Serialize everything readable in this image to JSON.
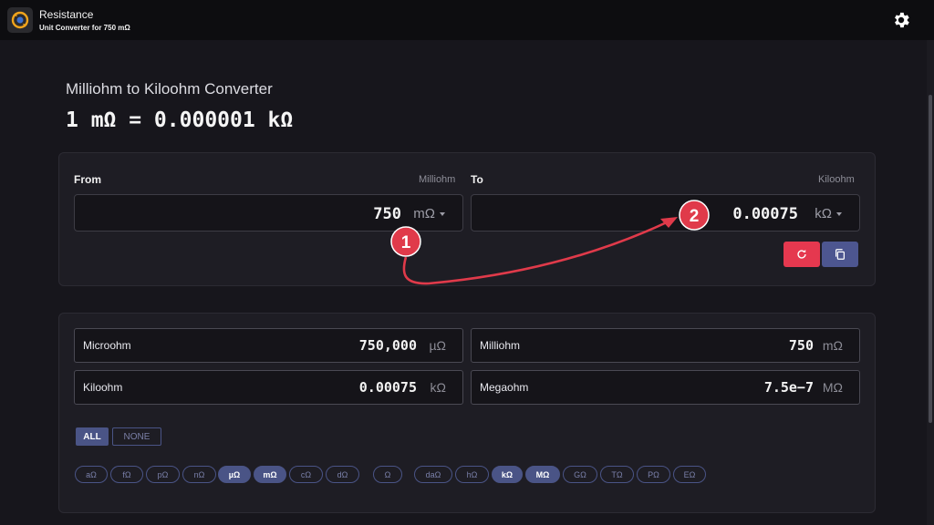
{
  "header": {
    "title": "Resistance",
    "subtitle": "Unit Converter for 750 mΩ"
  },
  "page": {
    "heading": "Milliohm to Kiloohm Converter",
    "formula": "1 mΩ = 0.000001 kΩ"
  },
  "converter": {
    "from_label": "From",
    "from_unit_name": "Milliohm",
    "from_value": "750",
    "from_unit": "mΩ",
    "to_label": "To",
    "to_unit_name": "Kiloohm",
    "to_value": "0.00075",
    "to_unit": "kΩ"
  },
  "results": [
    {
      "name": "Microohm",
      "value": "750,000",
      "unit": "µΩ"
    },
    {
      "name": "Milliohm",
      "value": "750",
      "unit": "mΩ"
    },
    {
      "name": "Kiloohm",
      "value": "0.00075",
      "unit": "kΩ"
    },
    {
      "name": "Megaohm",
      "value": "7.5e−7",
      "unit": "MΩ"
    }
  ],
  "filters": {
    "all_label": "ALL",
    "none_label": "NONE"
  },
  "chips": [
    {
      "label": "aΩ",
      "on": false
    },
    {
      "label": "fΩ",
      "on": false
    },
    {
      "label": "pΩ",
      "on": false
    },
    {
      "label": "nΩ",
      "on": false
    },
    {
      "label": "µΩ",
      "on": true
    },
    {
      "label": "mΩ",
      "on": true
    },
    {
      "label": "cΩ",
      "on": false
    },
    {
      "label": "dΩ",
      "on": false
    },
    {
      "label": "Ω",
      "on": false
    },
    {
      "label": "daΩ",
      "on": false
    },
    {
      "label": "hΩ",
      "on": false
    },
    {
      "label": "kΩ",
      "on": true
    },
    {
      "label": "MΩ",
      "on": true
    },
    {
      "label": "GΩ",
      "on": false
    },
    {
      "label": "TΩ",
      "on": false
    },
    {
      "label": "PΩ",
      "on": false
    },
    {
      "label": "EΩ",
      "on": false
    }
  ],
  "annotations": {
    "marker_1": "1",
    "marker_2": "2"
  },
  "colors": {
    "background": "#17161c",
    "panel": "#1e1d24",
    "accent": "#4a5486",
    "reset_button": "#e5384f",
    "annotation": "#e5384f"
  }
}
